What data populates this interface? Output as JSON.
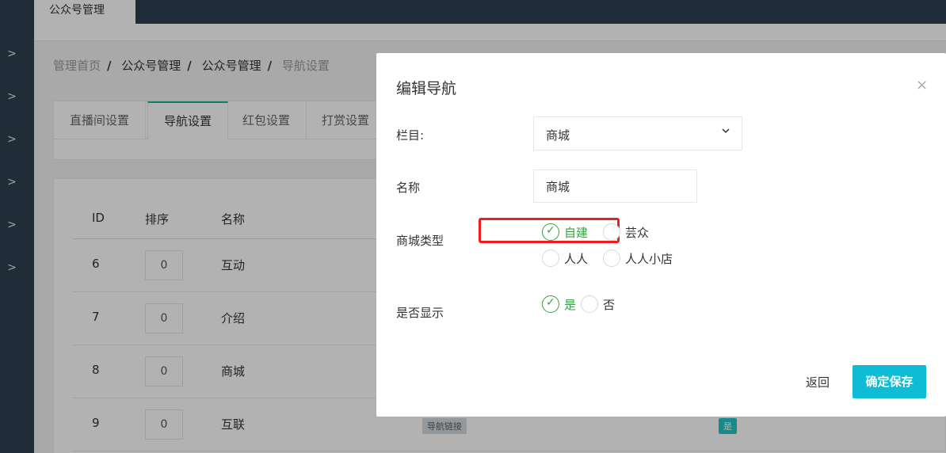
{
  "topbar": {
    "tab_label": "公众号管理"
  },
  "sidebar": {
    "items": [
      ">",
      ">",
      ">",
      ">",
      ">",
      ">"
    ]
  },
  "breadcrumb": {
    "home": "管理首页",
    "level1": "公众号管理",
    "level2": "公众号管理",
    "current": "导航设置",
    "separator": "/"
  },
  "page_tabs": [
    {
      "label": "直播间设置"
    },
    {
      "label": "导航设置"
    },
    {
      "label": "红包设置"
    },
    {
      "label": "打赏设置"
    }
  ],
  "table": {
    "headers": {
      "id": "ID",
      "sort": "排序",
      "name": "名称"
    },
    "rows": [
      {
        "id": "6",
        "sort": "0",
        "name": "互动"
      },
      {
        "id": "7",
        "sort": "0",
        "name": "介绍"
      },
      {
        "id": "8",
        "sort": "0",
        "name": "商城"
      },
      {
        "id": "9",
        "sort": "0",
        "name": "互联"
      }
    ],
    "row9_link_badge": "导航链接",
    "row9_show_badge": "是"
  },
  "modal": {
    "title": "编辑导航",
    "close_symbol": "×",
    "column_label": "栏目:",
    "column_value": "商城",
    "name_label": "名称",
    "name_value": "商城",
    "shop_type_label": "商城类型",
    "shop_type_options": [
      {
        "label": "自建",
        "checked": true
      },
      {
        "label": "芸众",
        "checked": false
      },
      {
        "label": "人人",
        "checked": false
      },
      {
        "label": "人人小店",
        "checked": false
      }
    ],
    "display_label": "是否显示",
    "display_options": [
      {
        "label": "是",
        "checked": true
      },
      {
        "label": "否",
        "checked": false
      }
    ],
    "back_label": "返回",
    "save_label": "确定保存"
  },
  "colors": {
    "primary": "#0fbcd6",
    "checked_green": "#3aa047",
    "sidebar": "#2f4050",
    "highlight": "#ef1d1d"
  }
}
